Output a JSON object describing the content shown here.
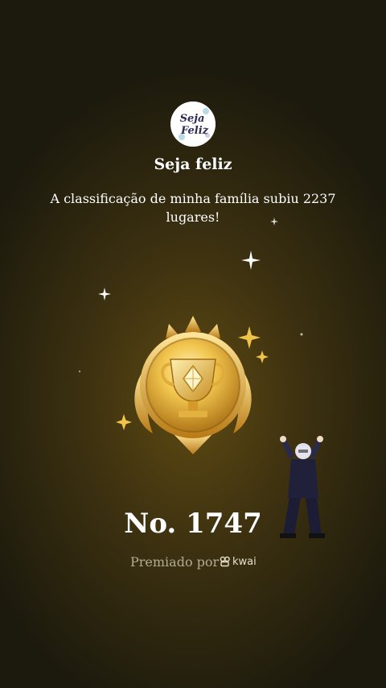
{
  "header": {
    "avatar_text_line1": "Seja",
    "avatar_text_line2": "Feliz",
    "family_name": "Seja feliz",
    "message": "A classificação de minha família subiu 2237 lugares!"
  },
  "badge": {
    "icon": "trophy-medal-icon",
    "rank": "No. 1747"
  },
  "footer": {
    "awarded_by": "Premiado por",
    "brand": "kwai",
    "brand_icon": "kwai-logo-icon"
  },
  "decoration": {
    "sparkle_icon": "sparkle-icon",
    "character": "dancing-character"
  },
  "colors": {
    "gold": "#e6b53a",
    "muted_text": "#b3ab95"
  }
}
